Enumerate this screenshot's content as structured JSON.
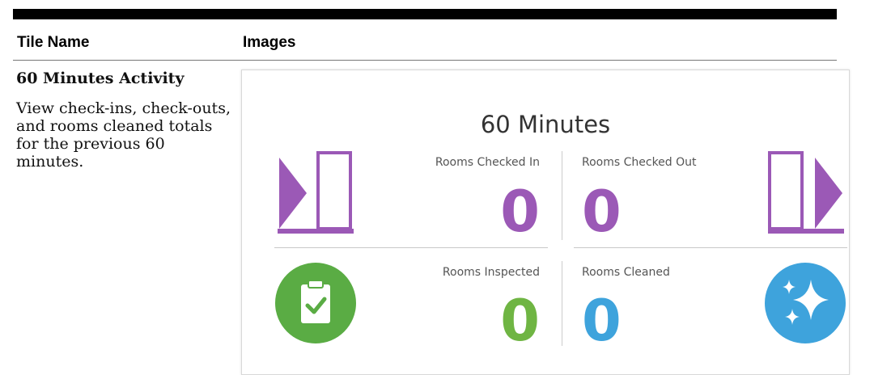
{
  "table": {
    "header_tile_name": "Tile Name",
    "header_images": "Images"
  },
  "row": {
    "tile_name": "60 Minutes Activity",
    "description": "View check-ins, check-outs, and rooms cleaned totals for the previous 60 minutes."
  },
  "tile": {
    "title": "60 Minutes",
    "stats": {
      "checked_in": {
        "label": "Rooms Checked In",
        "value": "0",
        "color": "#9b59b6"
      },
      "checked_out": {
        "label": "Rooms Checked Out",
        "value": "0",
        "color": "#9b59b6"
      },
      "inspected": {
        "label": "Rooms Inspected",
        "value": "0",
        "color": "#6fb543"
      },
      "cleaned": {
        "label": "Rooms Cleaned",
        "value": "0",
        "color": "#3ea3dc"
      }
    },
    "icons": {
      "checked_in": "door-enter-icon",
      "checked_out": "door-exit-icon",
      "inspected": "clipboard-check-icon",
      "cleaned": "sparkle-icon"
    }
  }
}
